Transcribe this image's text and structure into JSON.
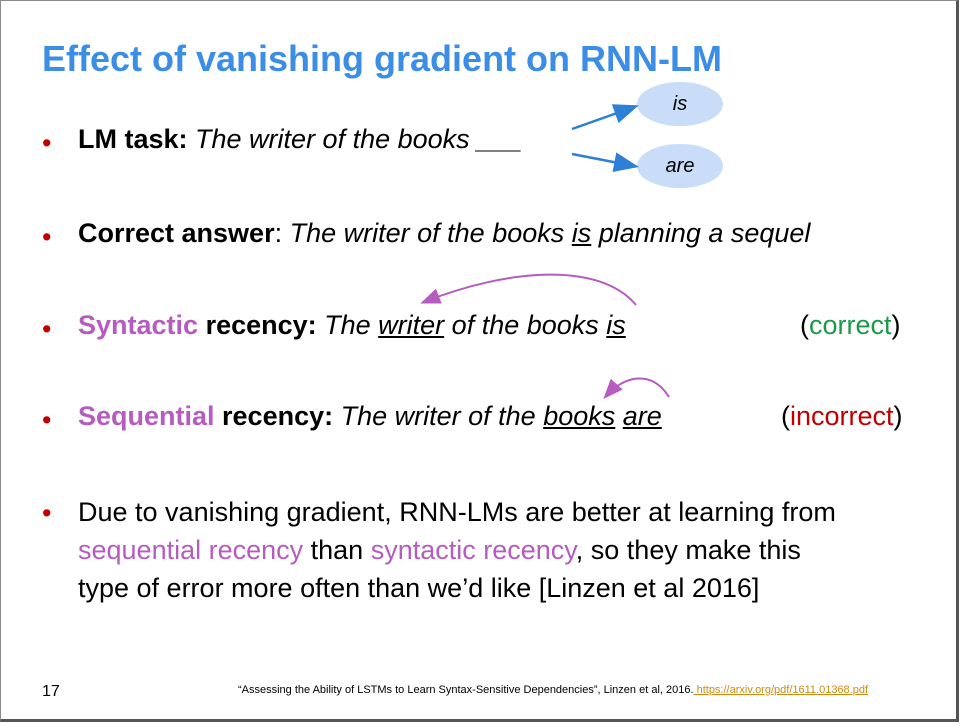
{
  "title": "Effect of vanishing gradient on RNN-LM",
  "bullet_char": "•",
  "b1": {
    "label": "LM task:",
    "text": " The writer of the books ___"
  },
  "ovals": {
    "top": "is",
    "bottom": "are"
  },
  "b2": {
    "label": "Correct answer",
    "colon": ": ",
    "text_a": "The writer of the books ",
    "text_u": "is",
    "text_b": " planning a sequel"
  },
  "b3": {
    "label_a": "Syntactic",
    "label_b": " recency:",
    "text_a": " The ",
    "u1": "writer",
    "text_b": " of the books ",
    "u2": "is",
    "note_open": "(",
    "note": "correct",
    "note_close": ")"
  },
  "b4": {
    "label_a": "Sequential",
    "label_b": " recency:",
    "text_a": " The writer of the ",
    "u1": "books",
    "sp": " ",
    "u2": "are",
    "note_open": "(",
    "note": "incorrect",
    "note_close": ")"
  },
  "b5": {
    "t1": "Due to vanishing gradient, RNN-LMs are better at learning from",
    "p1": "sequential recency",
    "t2": " than ",
    "p2": "syntactic recency",
    "t3": ", so they make this",
    "t4": "type of error more often than we’d like [Linzen et al 2016]"
  },
  "page_number": "17",
  "footer": {
    "citation": "“Assessing the Ability of LSTMs to Learn Syntax-Sensitive Dependencies”, Linzen et al, 2016.",
    "link": " https://arxiv.org/pdf/1611.01368.pdf"
  }
}
